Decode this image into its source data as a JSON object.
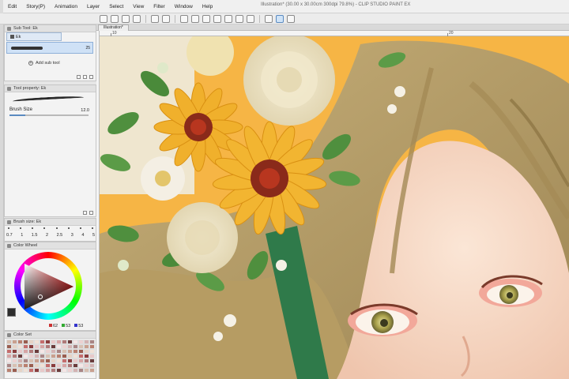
{
  "app": {
    "title": "Illustration* (30.00 x 30.00cm 300dpi 79.8%) - CLIP STUDIO PAINT EX"
  },
  "menu": [
    "Edit",
    "Story(P)",
    "Animation",
    "Layer",
    "Select",
    "View",
    "Filter",
    "Window",
    "Help"
  ],
  "document_tab": "Illustration*",
  "ruler": {
    "marks": [
      "10",
      "20"
    ]
  },
  "subtool_panel": {
    "header": "Sub Tool: Ek",
    "tab": "Ek",
    "item_value": "25",
    "add_label": "Add sub tool"
  },
  "tool_property": {
    "header": "Tool property: Ek",
    "brush_size_label": "Brush Size",
    "brush_size_value": "12.0"
  },
  "brush_size_panel": {
    "header": "Brush size: Ek",
    "values": [
      "0.7",
      "1",
      "1.5",
      "2",
      "2.5",
      "3",
      "4",
      "5"
    ]
  },
  "color_wheel": {
    "header": "Color Wheel",
    "h": "62",
    "s": "53",
    "v": "53",
    "current_color": "#2d2d2d"
  },
  "color_set": {
    "header": "Color Set"
  },
  "colors": {
    "background_orange": "#f6b545",
    "accent_blue": "#5a8ac0"
  }
}
